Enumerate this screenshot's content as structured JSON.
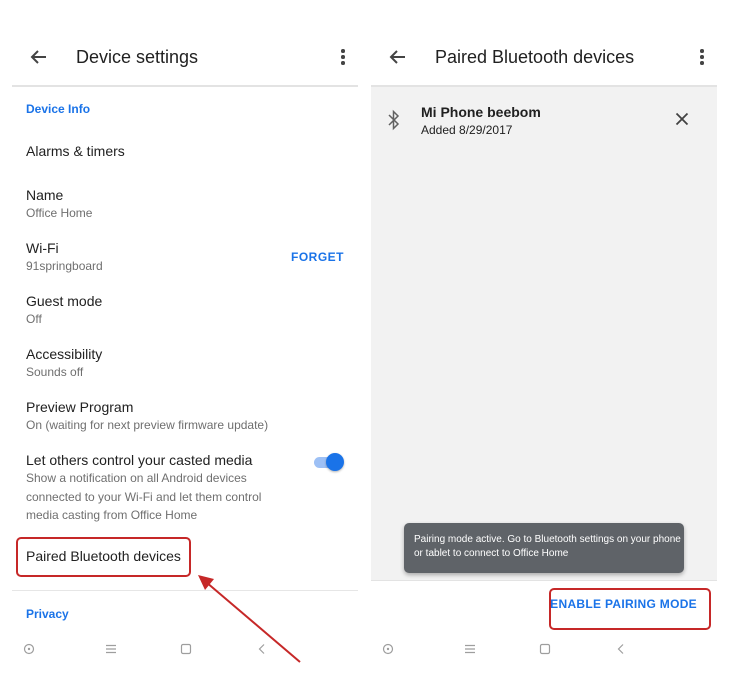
{
  "left_screen": {
    "title": "Device settings",
    "section_device_info": "Device Info",
    "items": {
      "alarms": {
        "title": "Alarms & timers"
      },
      "name": {
        "title": "Name",
        "subtitle": "Office Home"
      },
      "wifi": {
        "title": "Wi-Fi",
        "subtitle": "91springboard",
        "action": "FORGET"
      },
      "guest": {
        "title": "Guest mode",
        "subtitle": "Off"
      },
      "accessibility": {
        "title": "Accessibility",
        "subtitle": "Sounds off"
      },
      "preview": {
        "title": "Preview Program",
        "subtitle": "On (waiting for next preview firmware update)"
      },
      "casting": {
        "title": "Let others control your casted media",
        "subtitle_lines": [
          "Show a notification on all Android devices",
          "connected to your Wi-Fi and let them control",
          "media casting from Office Home"
        ],
        "toggle_on": true
      },
      "paired": {
        "title": "Paired Bluetooth devices"
      }
    },
    "section_privacy": "Privacy"
  },
  "right_screen": {
    "title": "Paired Bluetooth devices",
    "device": {
      "name": "Mi Phone beebom",
      "added": "Added 8/29/2017"
    },
    "snackbar_lines": [
      "Pairing mode active. Go to Bluetooth settings on your phone",
      "or tablet to connect to Office Home"
    ],
    "action": "ENABLE PAIRING MODE"
  },
  "colors": {
    "accent": "#1a73e8",
    "highlight": "#c62828",
    "snackbar": "#5f6368"
  },
  "icons": [
    "back-icon",
    "more-vert-icon",
    "bluetooth-icon",
    "close-icon",
    "nav-circle-icon",
    "nav-menu-icon",
    "nav-square-icon",
    "nav-back-icon"
  ]
}
